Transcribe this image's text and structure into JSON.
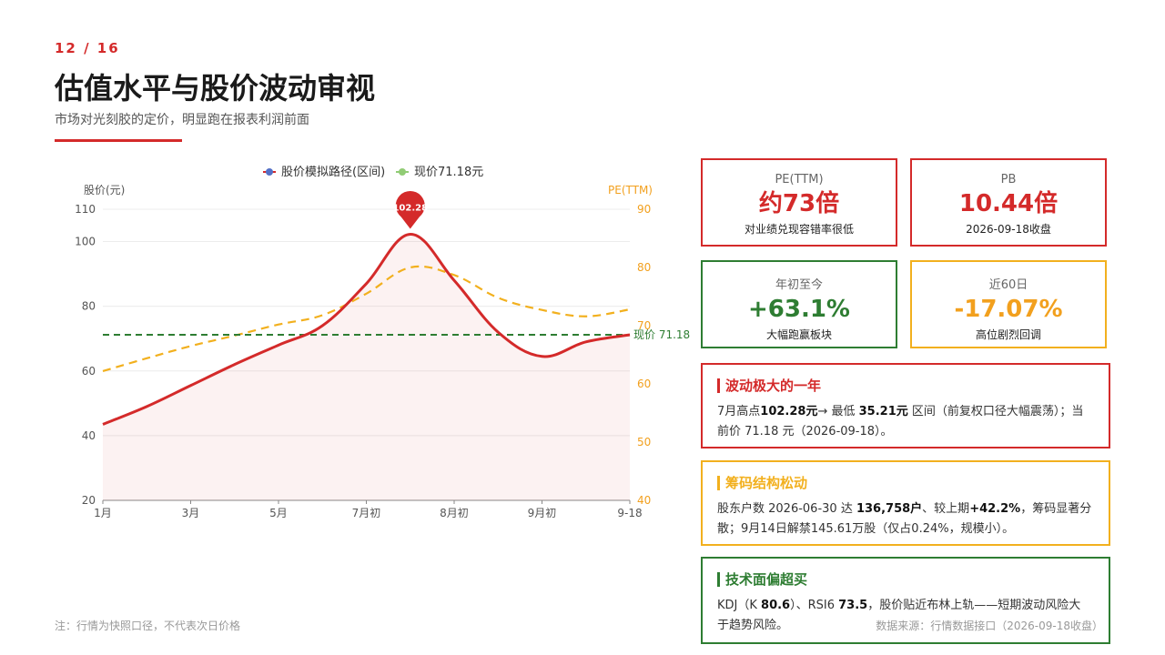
{
  "header": {
    "page_indicator": "12 / 16",
    "title": "估值水平与股价波动审视",
    "subtitle": "市场对光刻胶的定价，明显跑在报表利润前面"
  },
  "footer": {
    "note": "注：行情为快照口径，不代表次日价格",
    "source": "数据来源：行情数据接口（2026-09-18收盘）"
  },
  "colors": {
    "accent_red": "#d42a2a",
    "accent_green": "#2e7d32",
    "accent_orange": "#f2b01e"
  },
  "kpis": [
    {
      "label": "PE(TTM)",
      "value": "约73倍",
      "note": "对业绩兑现容错率很低",
      "color": "red"
    },
    {
      "label": "PB",
      "value": "10.44倍",
      "note": "2026-09-18收盘",
      "color": "red"
    },
    {
      "label": "年初至今",
      "value": "+63.1%",
      "note": "大幅跑赢板块",
      "color": "green"
    },
    {
      "label": "近60日",
      "value": "-17.07%",
      "note": "高位剧烈回调",
      "color": "orange"
    }
  ],
  "cards": [
    {
      "title": "波动极大的一年",
      "color": "red",
      "parts": [
        {
          "t": "7月高点"
        },
        {
          "t": "102.28元",
          "b": true
        },
        {
          "t": "→ 最低 "
        },
        {
          "t": "35.21元",
          "b": true
        },
        {
          "t": " 区间（前复权口径大幅震荡）；当前价 71.18 元（2026-09-18）。"
        }
      ]
    },
    {
      "title": "筹码结构松动",
      "color": "orange",
      "parts": [
        {
          "t": "股东户数 2026-06-30 达 "
        },
        {
          "t": "136,758户",
          "b": true
        },
        {
          "t": "、较上期"
        },
        {
          "t": "+42.2%",
          "b": true
        },
        {
          "t": "，筹码显著分散；9月14日解禁145.61万股（仅占0.24%，规模小）。"
        }
      ]
    },
    {
      "title": "技术面偏超买",
      "color": "green",
      "parts": [
        {
          "t": "KDJ（K "
        },
        {
          "t": "80.6",
          "b": true
        },
        {
          "t": "）、RSI6 "
        },
        {
          "t": "73.5",
          "b": true
        },
        {
          "t": "，股价贴近布林上轨——短期波动风险大于趋势风险。"
        }
      ]
    }
  ],
  "chart_data": {
    "type": "line",
    "legend": [
      "股价模拟路径(区间)",
      "现价71.18元"
    ],
    "legend_position": "top-center",
    "x_labels": [
      "1月",
      "3月",
      "5月",
      "7月初",
      "8月初",
      "9月初",
      "9-18"
    ],
    "left_axis": {
      "label": "股价(元)",
      "range": [
        20,
        110
      ],
      "ticks": [
        20,
        40,
        60,
        80,
        100,
        110
      ]
    },
    "right_axis": {
      "label": "PE(TTM)",
      "range": [
        40,
        90
      ],
      "ticks": [
        40,
        50,
        60,
        70,
        80,
        90
      ]
    },
    "series": [
      {
        "name": "股价模拟路径(区间)",
        "axis": "left",
        "color": "#d42a2a",
        "area": true,
        "x": [
          0,
          0.5,
          1,
          1.5,
          2,
          2.5,
          3,
          3.5,
          4,
          4.5,
          5,
          5.5,
          6
        ],
        "values": [
          43.5,
          49,
          55.5,
          62,
          68,
          74,
          87,
          102.28,
          88,
          72,
          64.5,
          69,
          71.18
        ]
      },
      {
        "axis": "right",
        "color": "#f2b01e",
        "style": "dashed",
        "x": [
          0,
          0.5,
          1,
          1.5,
          2,
          2.5,
          3,
          3.5,
          4,
          4.5,
          5,
          5.5,
          6
        ],
        "values": [
          62.2,
          64.4,
          66.5,
          68.3,
          70.2,
          71.8,
          75.5,
          80,
          78.7,
          74.8,
          72.7,
          71.6,
          72.8
        ]
      },
      {
        "name": "现价71.18元",
        "axis": "left",
        "color": "#2e7d32",
        "style": "dashed",
        "constant": 71.18,
        "label": "现价 71.18"
      }
    ],
    "annotation": {
      "label": "102.28",
      "x": 3.5,
      "y": 102.28
    }
  }
}
